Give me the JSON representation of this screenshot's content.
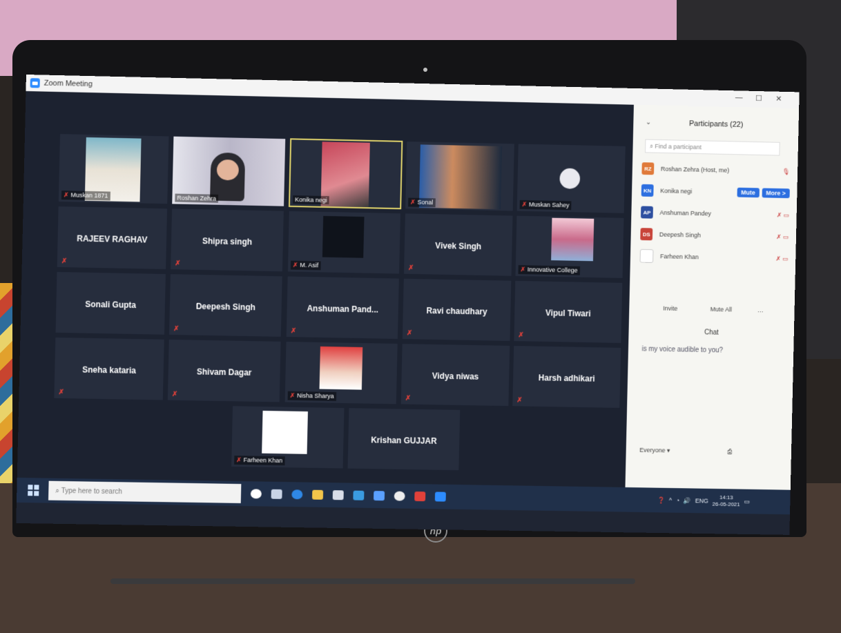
{
  "window": {
    "title": "Zoom Meeting"
  },
  "tiles": {
    "t1": "Muskan 1871",
    "t2": "Roshan Zehra",
    "t3": "Konika negi",
    "t4": "Sonal",
    "t5": "Muskan Sahey",
    "t6": "RAJEEV RAGHAV",
    "t7": "Shipra singh",
    "t8": "M. Asif",
    "t9": "Vivek Singh",
    "t10": "Innovative College",
    "t11": "Sonali Gupta",
    "t12": "Deepesh Singh",
    "t13": "Anshuman Pand...",
    "t14": "Ravi chaudhary",
    "t15": "Vipul Tiwari",
    "t16": "Sneha kataria",
    "t17": "Shivam Dagar",
    "t18": "Nisha Sharya",
    "t19": "Vidya niwas",
    "t20": "Harsh adhikari",
    "t21": "Farheen Khan",
    "t22": "Krishan GUJJAR"
  },
  "participants_panel": {
    "title": "Participants (22)",
    "search_placeholder": "Find a participant",
    "rows": [
      {
        "initials": "RZ",
        "name": "Roshan Zehra (Host, me)",
        "color": "#e07a3a"
      },
      {
        "initials": "KN",
        "name": "Konika negi",
        "color": "#2d6fe0",
        "mute_label": "Mute",
        "more_label": "More >"
      },
      {
        "initials": "AP",
        "name": "Anshuman Pandey",
        "color": "#2d4fa0"
      },
      {
        "initials": "DS",
        "name": "Deepesh Singh",
        "color": "#c8443a"
      },
      {
        "initials": "",
        "name": "Farheen Khan",
        "color": "#ffffff"
      }
    ],
    "invite_label": "Invite",
    "mute_all_label": "Mute All",
    "chat": {
      "title": "Chat",
      "message_1": "is my voice audible to you?",
      "send_to_label": "Everyone"
    }
  },
  "taskbar": {
    "search_placeholder": "Type here to search",
    "lang": "ENG",
    "time": "14:13",
    "date": "26-05-2021"
  },
  "laptop": {
    "brand": "hp"
  }
}
